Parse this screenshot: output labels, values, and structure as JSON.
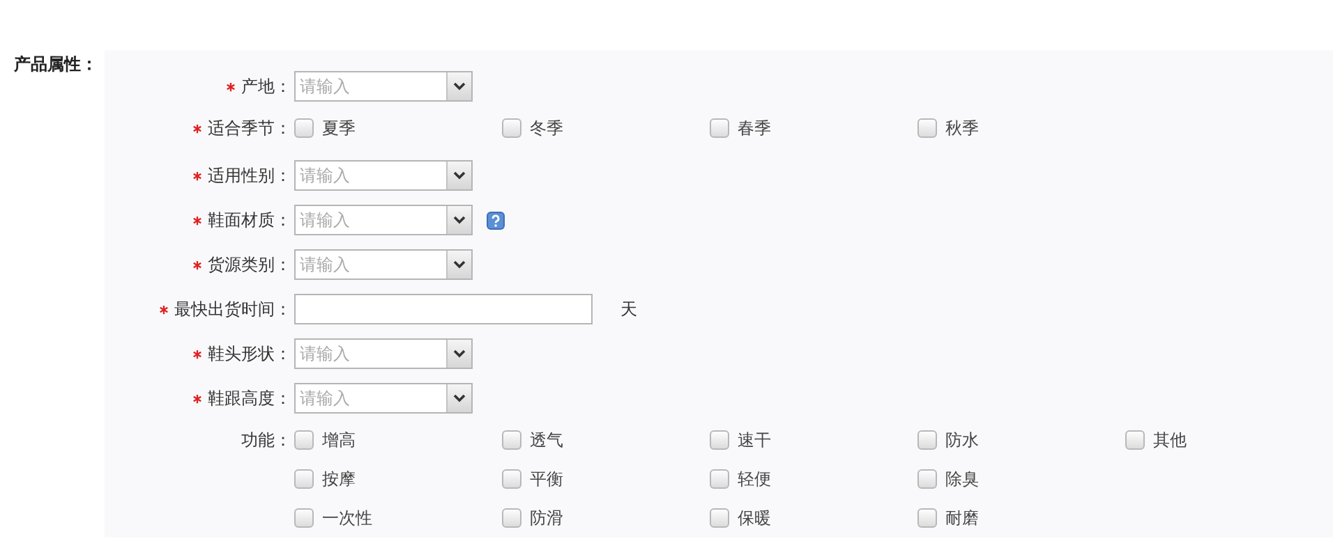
{
  "section": {
    "title": "产品属性："
  },
  "fields": [
    {
      "kind": "select",
      "label": "产地：",
      "required": true,
      "placeholder": "请输入",
      "help": false
    },
    {
      "kind": "checkboxes",
      "label": "适合季节：",
      "required": true,
      "option_rows": [
        [
          {
            "label": "夏季",
            "checked": false
          },
          {
            "label": "冬季",
            "checked": false
          },
          {
            "label": "春季",
            "checked": false
          },
          {
            "label": "秋季",
            "checked": false
          }
        ]
      ]
    },
    {
      "kind": "select",
      "label": "适用性别：",
      "required": true,
      "placeholder": "请输入",
      "help": false
    },
    {
      "kind": "select",
      "label": "鞋面材质：",
      "required": true,
      "placeholder": "请输入",
      "help": true
    },
    {
      "kind": "select",
      "label": "货源类别：",
      "required": true,
      "placeholder": "请输入",
      "help": false
    },
    {
      "kind": "text",
      "label": "最快出货时间：",
      "required": true,
      "unit": "天"
    },
    {
      "kind": "select",
      "label": "鞋头形状：",
      "required": true,
      "placeholder": "请输入",
      "help": false
    },
    {
      "kind": "select",
      "label": "鞋跟高度：",
      "required": true,
      "placeholder": "请输入",
      "help": false
    },
    {
      "kind": "checkboxes",
      "label": "功能：",
      "required": false,
      "option_rows": [
        [
          {
            "label": "增高",
            "checked": false
          },
          {
            "label": "透气",
            "checked": false
          },
          {
            "label": "速干",
            "checked": false
          },
          {
            "label": "防水",
            "checked": false
          },
          {
            "label": "其他",
            "checked": false
          }
        ],
        [
          {
            "label": "按摩",
            "checked": false
          },
          {
            "label": "平衡",
            "checked": false
          },
          {
            "label": "轻便",
            "checked": false
          },
          {
            "label": "除臭",
            "checked": false
          }
        ],
        [
          {
            "label": "一次性",
            "checked": false
          },
          {
            "label": "防滑",
            "checked": false
          },
          {
            "label": "保暖",
            "checked": false
          },
          {
            "label": "耐磨",
            "checked": false
          }
        ]
      ]
    }
  ]
}
